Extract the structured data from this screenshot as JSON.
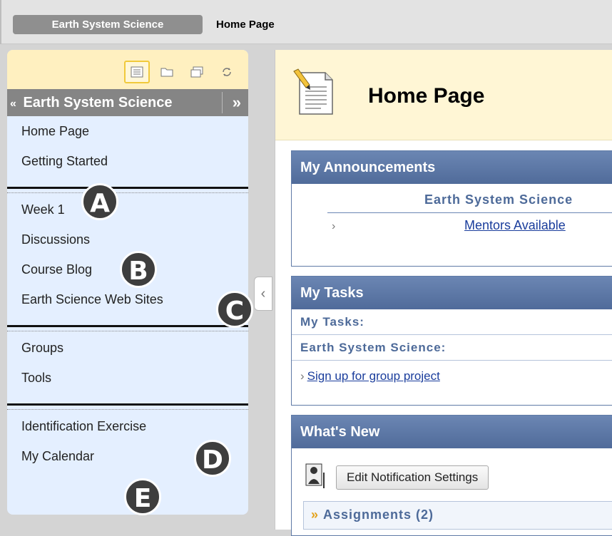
{
  "breadcrumb": {
    "course": "Earth System Science",
    "page": "Home Page"
  },
  "menu": {
    "title": "Earth System Science",
    "group1": [
      "Home Page",
      "Getting Started"
    ],
    "group2": [
      "Week 1",
      "Discussions",
      "Course Blog",
      "Earth Science Web Sites"
    ],
    "group3": [
      "Groups",
      "Tools"
    ],
    "group4": [
      "Identification Exercise",
      "My Calendar"
    ],
    "tool_icons": [
      "list-view-icon",
      "folder-view-icon",
      "new-window-icon",
      "refresh-icon"
    ]
  },
  "badges": [
    "A",
    "B",
    "C",
    "D",
    "E"
  ],
  "page": {
    "title": "Home Page"
  },
  "announcements": {
    "header": "My Announcements",
    "course": "Earth System Science",
    "link": "Mentors Available"
  },
  "tasks": {
    "header": "My Tasks",
    "label": "My Tasks:",
    "course": "Earth System Science:",
    "link": "Sign up for group project"
  },
  "whats_new": {
    "header": "What's New",
    "button": "Edit Notification Settings",
    "assignments": "Assignments (2)"
  },
  "colors": {
    "menu_bg": "#e4efff",
    "module_header": "#5f7aa6",
    "header_bg": "#fff6d5"
  }
}
